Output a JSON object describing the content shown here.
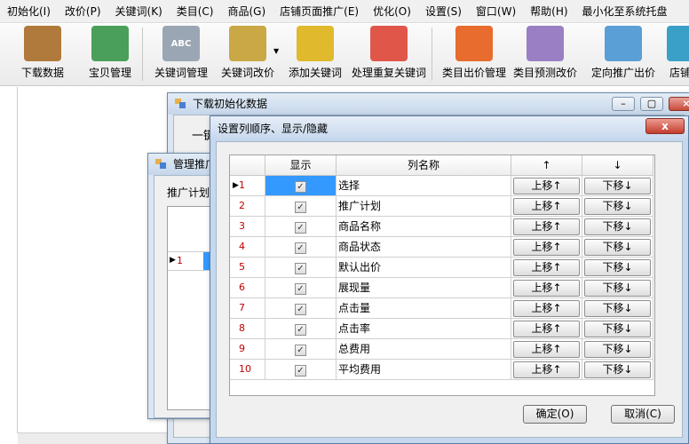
{
  "menu": [
    "初始化(I)",
    "改价(P)",
    "关键词(K)",
    "类目(C)",
    "商品(G)",
    "店铺页面推广(E)",
    "优化(O)",
    "设置(S)",
    "窗口(W)",
    "帮助(H)",
    "最小化至系统托盘"
  ],
  "toolbar": [
    {
      "label": "下载数据",
      "icon": "box-download-icon",
      "color": "#b07a3c"
    },
    {
      "label": "宝贝管理",
      "icon": "spreadsheet-icon",
      "color": "#4aa05a"
    },
    {
      "label": "关键词管理",
      "icon": "abc-text-icon",
      "color": "#9aa6b3",
      "icon_text": "ABC"
    },
    {
      "label": "关键词改价",
      "icon": "pencil-notepad-icon",
      "color": "#c9a845"
    },
    {
      "label": "添加关键词",
      "icon": "construction-icon",
      "color": "#e0b92c"
    },
    {
      "label": "处理重复关键词",
      "icon": "color-blocks-icon",
      "color": "#e0574a"
    },
    {
      "label": "类目出价管理",
      "icon": "pie-chart-icon",
      "color": "#e76c2d"
    },
    {
      "label": "类目预测改价",
      "icon": "sine-wave-icon",
      "color": "#9b7fc4"
    },
    {
      "label": "定向推广出价",
      "icon": "globe-icon",
      "color": "#5a9fd6"
    },
    {
      "label": "店铺页",
      "icon": "store-icon",
      "color": "#3aa0c8"
    }
  ],
  "windows": {
    "download": {
      "title": "下载初始化数据",
      "body_text": "一键"
    },
    "manage": {
      "title": "管理推广",
      "tab_label": "推广计划",
      "row_number": "1"
    }
  },
  "dialog": {
    "title": "设置列顺序、显示/隐藏",
    "close_label": "x",
    "columns": {
      "show": "显示",
      "name": "列名称",
      "up": "↑",
      "down": "↓"
    },
    "rows": [
      {
        "num": "1",
        "name": "选择"
      },
      {
        "num": "2",
        "name": "推广计划"
      },
      {
        "num": "3",
        "name": "商品名称"
      },
      {
        "num": "4",
        "name": "商品状态"
      },
      {
        "num": "5",
        "name": "默认出价"
      },
      {
        "num": "6",
        "name": "展现量"
      },
      {
        "num": "7",
        "name": "点击量"
      },
      {
        "num": "8",
        "name": "点击率"
      },
      {
        "num": "9",
        "name": "总费用"
      },
      {
        "num": "10",
        "name": "平均费用"
      }
    ],
    "checked_mark": "✓",
    "up_label": "上移↑",
    "down_label": "下移↓",
    "ok_label": "确定(O)",
    "cancel_label": "取消(C)"
  }
}
